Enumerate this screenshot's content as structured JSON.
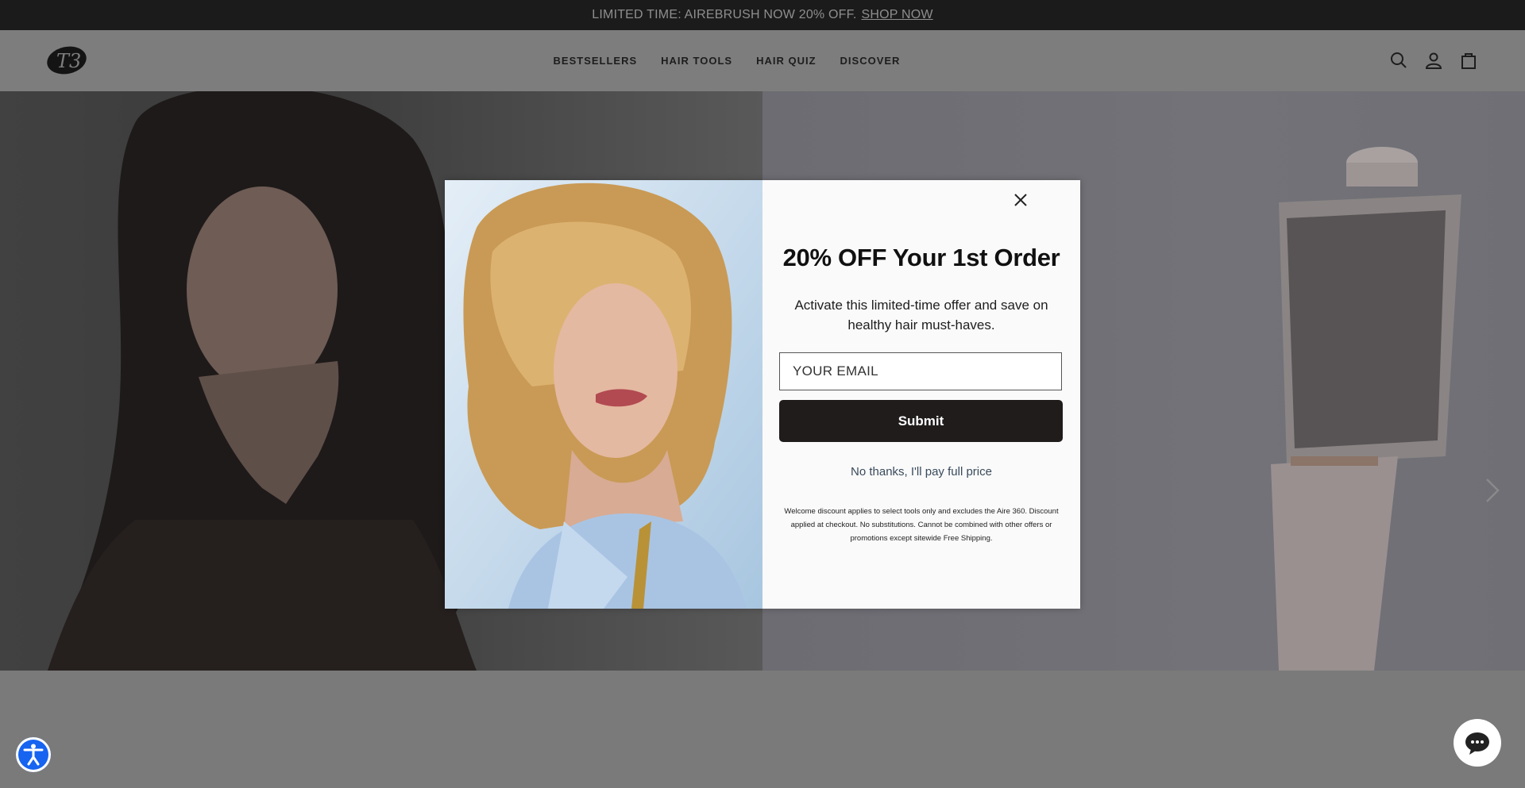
{
  "announcement": {
    "text": "LIMITED TIME: AIREBRUSH NOW 20% OFF.",
    "link": "SHOP NOW"
  },
  "header": {
    "logo_text": "T3",
    "nav": [
      "BESTSELLERS",
      "HAIR TOOLS",
      "HAIR QUIZ",
      "DISCOVER"
    ],
    "icons": [
      "search-icon",
      "account-icon",
      "cart-icon"
    ]
  },
  "modal": {
    "headline": "20% OFF Your 1st Order",
    "subtext": "Activate this limited-time offer and save on healthy hair must-haves.",
    "email_placeholder": "YOUR EMAIL",
    "submit_label": "Submit",
    "decline_label": "No thanks, I'll pay full price",
    "fine_print": "Welcome discount applies to select tools only and excludes the Aire 360. Discount applied at checkout. No substitutions. Cannot be combined with other offers or promotions except sitewide Free Shipping."
  },
  "colors": {
    "announcement_bg": "#1b1b1b",
    "submit_bg": "#201c1c",
    "accessibility_blue": "#1664f0"
  }
}
